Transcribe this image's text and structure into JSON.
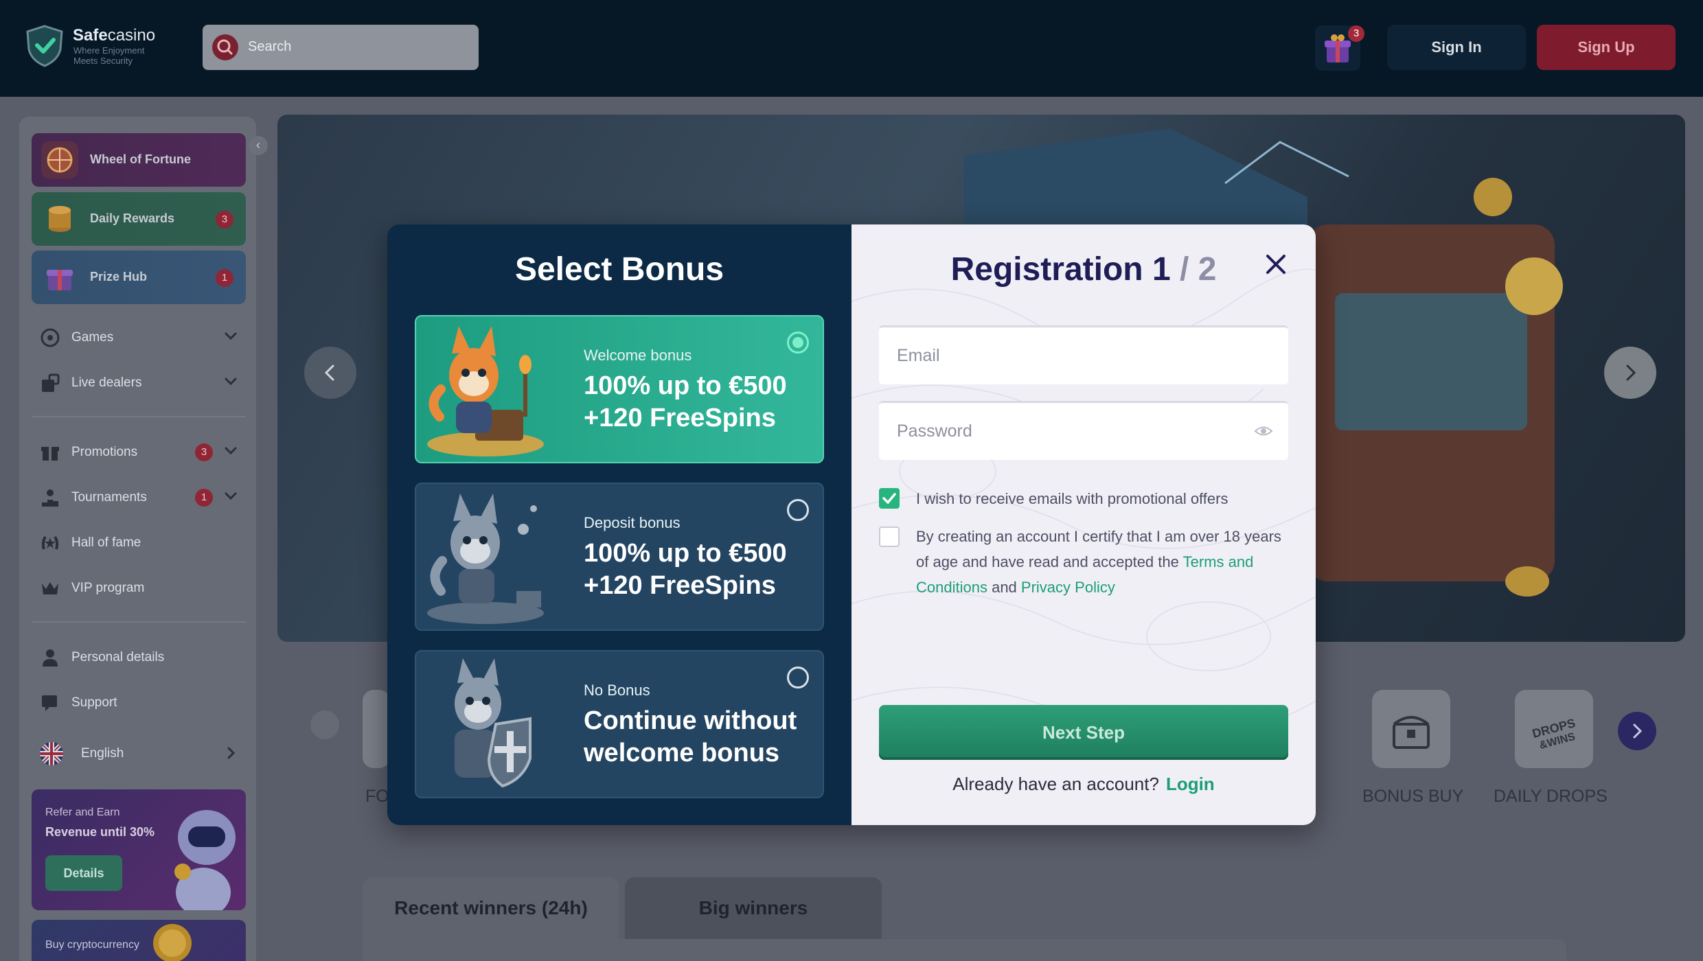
{
  "brand": {
    "name_bold": "Safe",
    "name_rest": "casino",
    "tagline": "Where Enjoyment Meets Security"
  },
  "header": {
    "search_placeholder": "Search",
    "gift_badge": "3",
    "sign_in": "Sign In",
    "sign_up": "Sign Up"
  },
  "sidebar": {
    "promos": [
      {
        "label": "Wheel of Fortune",
        "badge": ""
      },
      {
        "label": "Daily Rewards",
        "badge": "3"
      },
      {
        "label": "Prize Hub",
        "badge": "1"
      }
    ],
    "nav": [
      {
        "label": "Games",
        "icon": "games-icon"
      },
      {
        "label": "Live dealers",
        "icon": "live-dealers-icon"
      },
      {
        "label": "Promotions",
        "icon": "gift-icon",
        "badge": "3"
      },
      {
        "label": "Tournaments",
        "icon": "trophy-icon",
        "badge": "1"
      },
      {
        "label": "Hall of fame",
        "icon": "laurel-icon"
      },
      {
        "label": "VIP program",
        "icon": "crown-icon"
      },
      {
        "label": "Personal details",
        "icon": "person-icon"
      },
      {
        "label": "Support",
        "icon": "support-icon"
      }
    ],
    "language": "English",
    "refer": {
      "line1": "Refer and Earn",
      "line2": "Revenue until 30%",
      "button": "Details"
    },
    "crypto": {
      "line1": "Buy cryptocurrency"
    }
  },
  "categories": {
    "partial_left": "FO",
    "items": [
      "BONUS BUY",
      "DAILY DROPS"
    ]
  },
  "winners_tabs": {
    "active": "Recent winners (24h)",
    "inactive": "Big winners"
  },
  "modal": {
    "select_title": "Select Bonus",
    "bonuses": [
      {
        "type": "Welcome bonus",
        "line1": "100% up to €500",
        "line2": "+120 FreeSpins",
        "selected": true
      },
      {
        "type": "Deposit bonus",
        "line1": "100% up to €500",
        "line2": "+120 FreeSpins",
        "selected": false
      },
      {
        "type": "No Bonus",
        "line1": "Continue without",
        "line2": "welcome bonus",
        "selected": false
      }
    ],
    "reg_title": "Registration",
    "step_current": "1",
    "step_total": "/ 2",
    "email_placeholder": "Email",
    "password_placeholder": "Password",
    "checkbox_emails": "I wish to receive emails with promotional offers",
    "checkbox_terms_prefix": "By creating an account I certify that I am over 18 years of age and have read and accepted the",
    "terms_link": "Terms and Conditions",
    "and_text": "and",
    "privacy_link": "Privacy Policy",
    "next_button": "Next Step",
    "have_account": "Already have an account?",
    "login_link": "Login"
  },
  "colors": {
    "accent_green": "#1b9e78",
    "header_bg": "#061726",
    "modal_left_bg": "#0c2a45",
    "signup_red": "#7e1c2d"
  }
}
